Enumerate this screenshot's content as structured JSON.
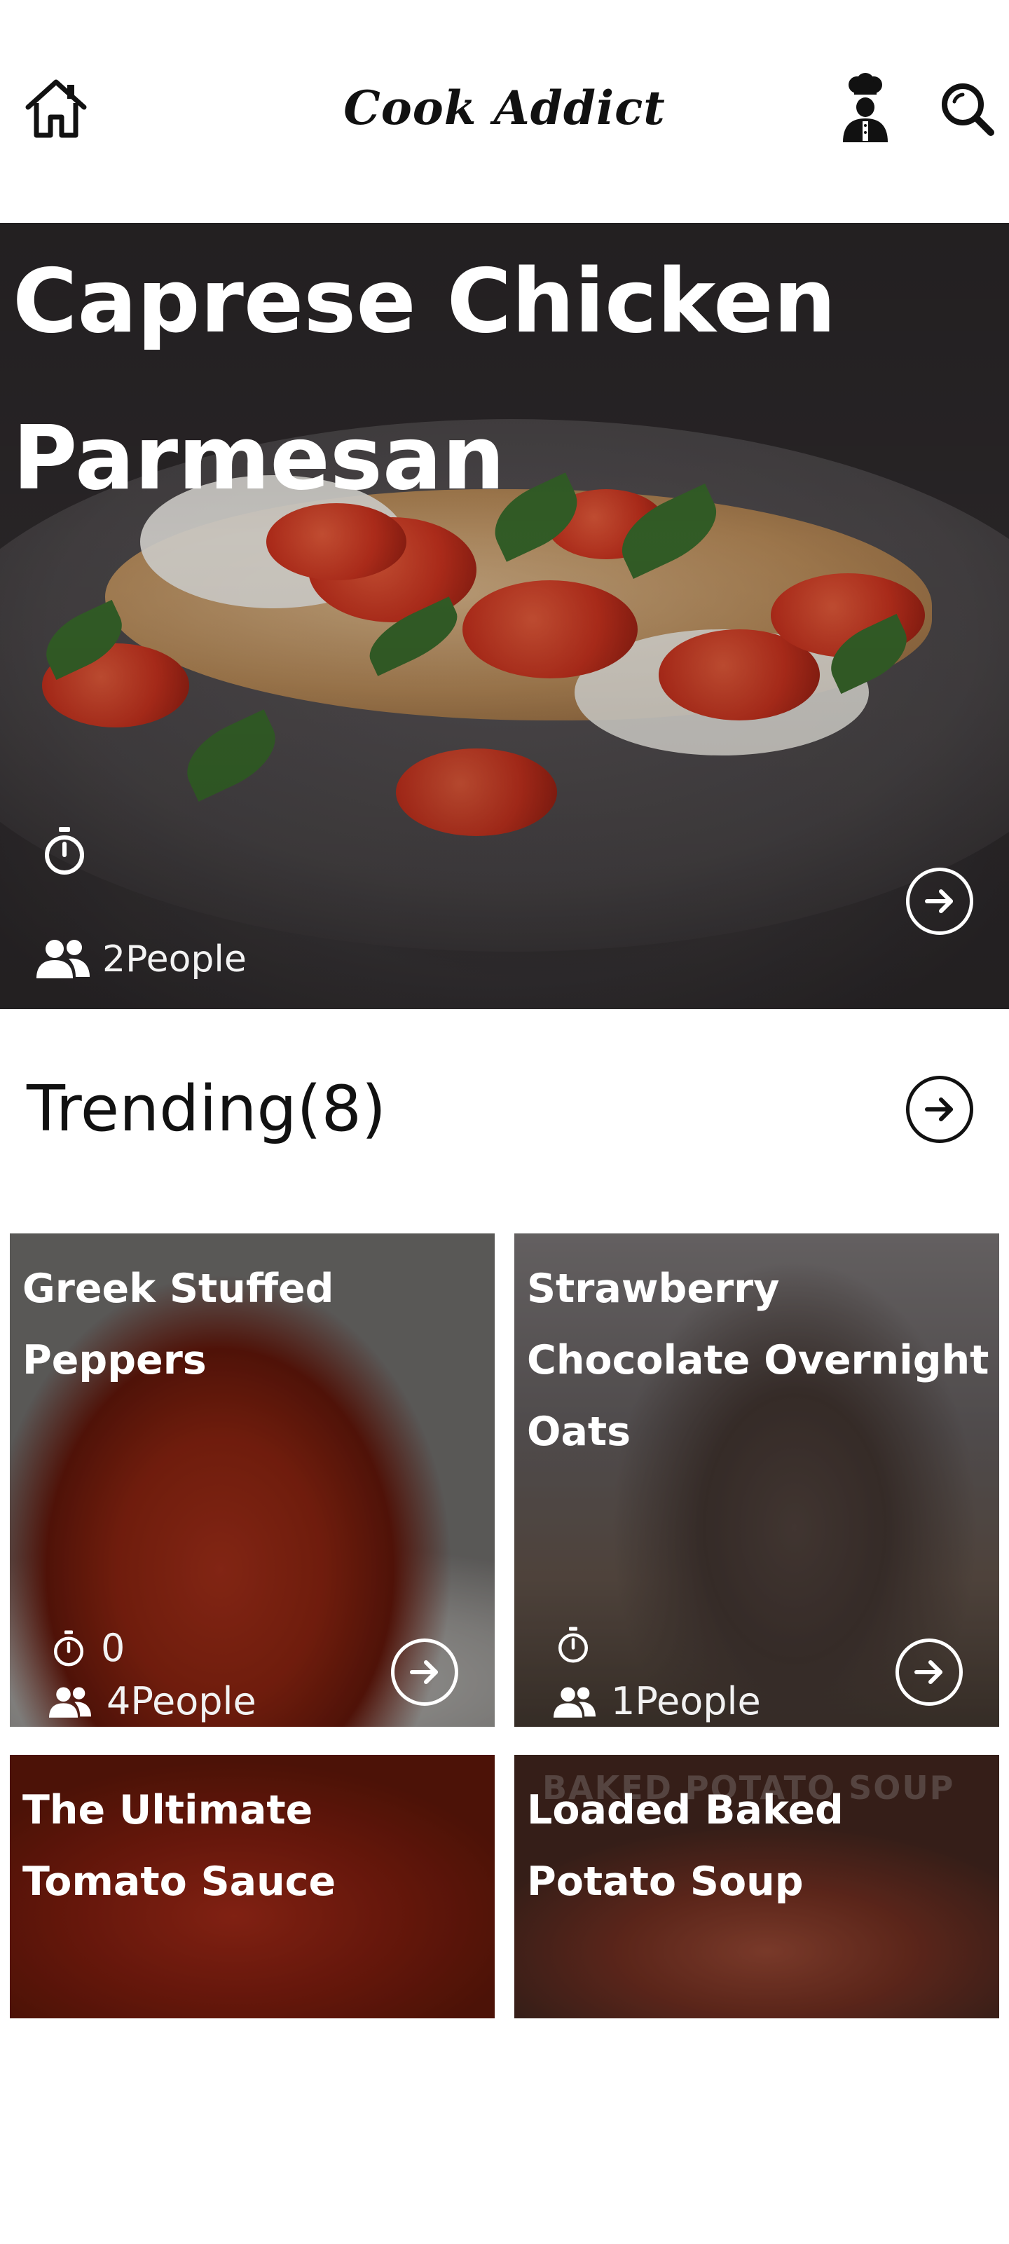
{
  "header": {
    "app_title": "Cook Addict",
    "icons": [
      "home-icon",
      "chef-icon",
      "search-icon"
    ]
  },
  "hero": {
    "title_line1": "Caprese Chicken",
    "title_line2": "Parmesan",
    "time_value": "",
    "people_label": "2People"
  },
  "trending": {
    "title": "Trending(8)"
  },
  "cards": [
    {
      "title": "Greek Stuffed Peppers",
      "time_value": "0",
      "people_label": "4People"
    },
    {
      "title": "Strawberry Chocolate Overnight Oats",
      "time_value": "",
      "people_label": "1People"
    },
    {
      "title": "The Ultimate Tomato Sauce"
    },
    {
      "title": "Loaded Baked Potato Soup",
      "watermark": "BAKED POTATO SOUP"
    }
  ],
  "colors": {
    "text_dark": "#111111",
    "overlay_text": "#ffffff",
    "background": "#ffffff"
  }
}
